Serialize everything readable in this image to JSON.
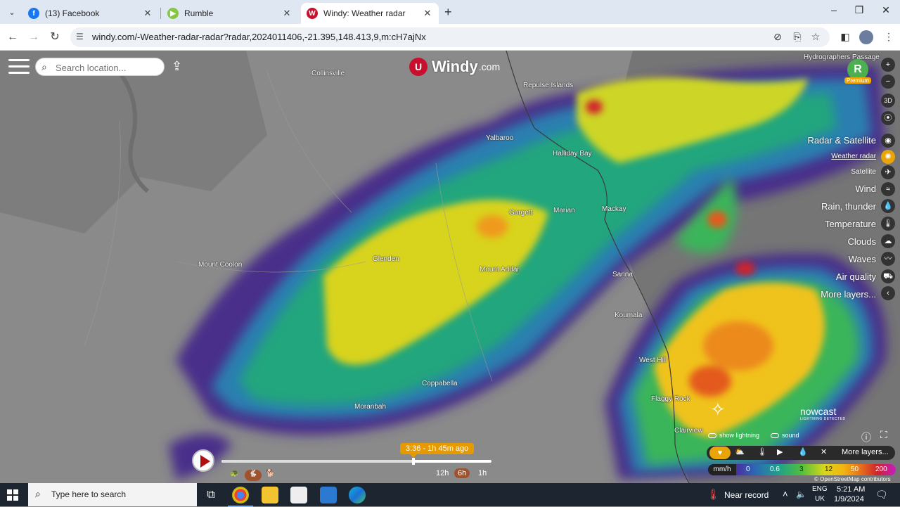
{
  "browser": {
    "tabs": [
      {
        "title": "(13) Facebook",
        "favicon": "facebook-icon",
        "color": "#1877f2"
      },
      {
        "title": "Rumble",
        "favicon": "rumble-icon",
        "color": "#85c742"
      },
      {
        "title": "Windy: Weather radar",
        "favicon": "windy-icon",
        "color": "#c8102e",
        "active": true
      }
    ],
    "url": "windy.com/-Weather-radar-radar?radar,2024011406,-21.395,148.413,9,m:cH7ajNx"
  },
  "search": {
    "placeholder": "Search location..."
  },
  "logo": {
    "word": "Windy",
    "suffix": ".com"
  },
  "premium": {
    "initial": "R",
    "label": "Premium"
  },
  "places": [
    {
      "name": "Collinsville",
      "key": "collinsville"
    },
    {
      "name": "Repulse Islands",
      "key": "repulse-islands"
    },
    {
      "name": "Hydrographers Passage",
      "key": "hydrographers-passage"
    },
    {
      "name": "Yalbaroo",
      "key": "yalbaroo"
    },
    {
      "name": "Halliday Bay",
      "key": "halliday-bay"
    },
    {
      "name": "Gargett",
      "key": "gargett"
    },
    {
      "name": "Marian",
      "key": "marian"
    },
    {
      "name": "Mackay",
      "key": "mackay"
    },
    {
      "name": "Mount Coolon",
      "key": "mount-coolon"
    },
    {
      "name": "Glenden",
      "key": "glenden"
    },
    {
      "name": "Mount Addar",
      "key": "mount-addar"
    },
    {
      "name": "Sarina",
      "key": "sarina"
    },
    {
      "name": "Koumala",
      "key": "koumala"
    },
    {
      "name": "West Hill",
      "key": "west-hill"
    },
    {
      "name": "Flaggy Rock",
      "key": "flaggy-rock"
    },
    {
      "name": "Coppabella",
      "key": "coppabella"
    },
    {
      "name": "Moranbah",
      "key": "moranbah"
    },
    {
      "name": "Clairview",
      "key": "clairview"
    }
  ],
  "layers": {
    "group": "Radar & Satellite",
    "selected": "Weather radar",
    "satellite": "Satellite",
    "items": [
      "Wind",
      "Rain, thunder",
      "Temperature",
      "Clouds",
      "Waves",
      "Air quality",
      "More layers..."
    ]
  },
  "map_controls": {
    "three_d": "3D"
  },
  "timeline": {
    "current": "3:36 - 1h 45m ago",
    "ranges": [
      "12h",
      "6h",
      "1h"
    ],
    "selected_range": "6h",
    "progress": 0.71
  },
  "nowcast": {
    "title": "nowcast",
    "subtitle": "LIGHTNING DETECTED"
  },
  "toggles": {
    "lightning": "show lightning",
    "sound": "sound"
  },
  "actionbar": {
    "more": "More layers..."
  },
  "legend": {
    "unit": "mm/h",
    "ticks": [
      "0",
      "0.6",
      "3",
      "12",
      "50",
      "200"
    ]
  },
  "attribution": "© OpenStreetMap contributors",
  "taskbar": {
    "search": "Type here to search",
    "weather": "Near record",
    "lang": "ENG",
    "region": "UK",
    "time": "5:21 AM",
    "date": "1/9/2024"
  }
}
